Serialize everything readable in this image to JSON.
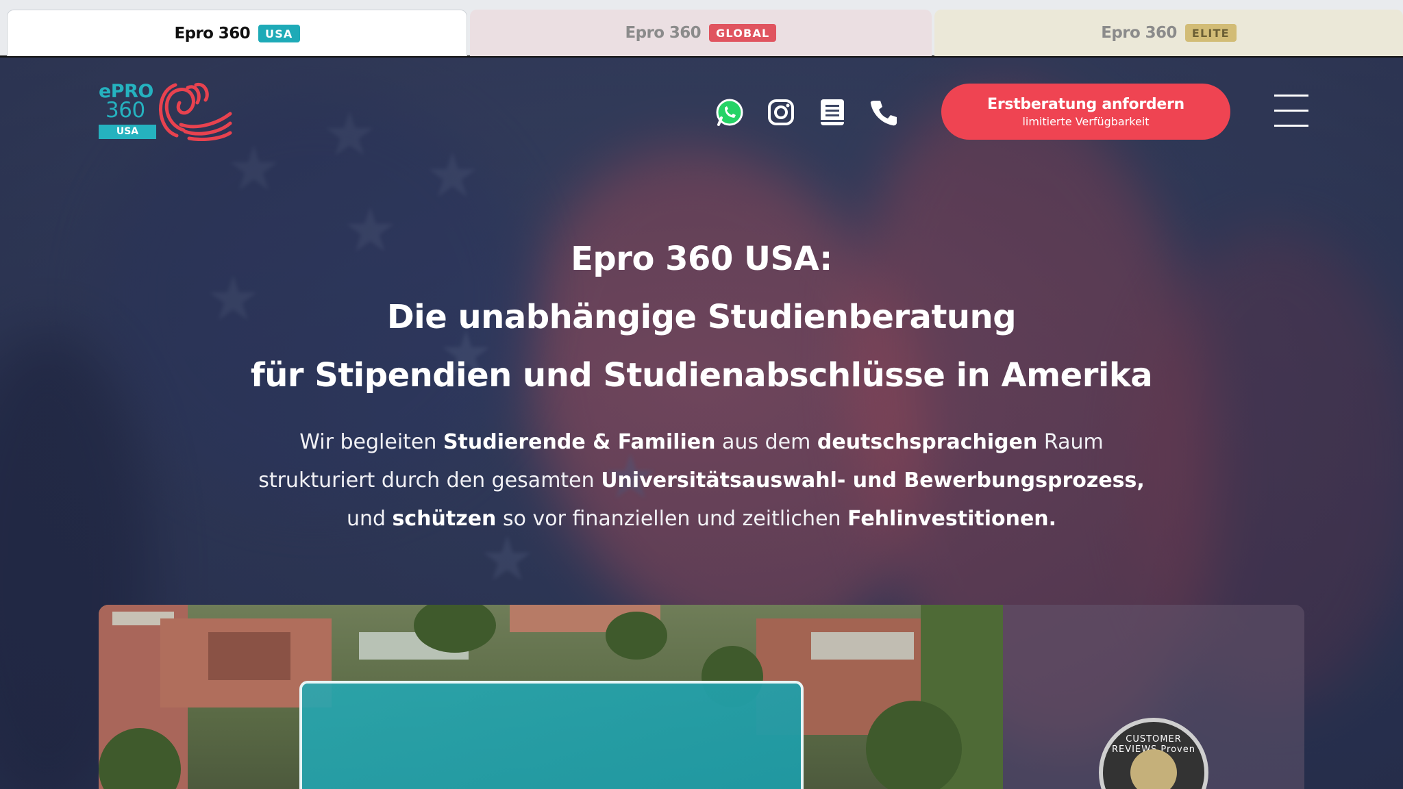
{
  "tabs": [
    {
      "name": "Epro 360",
      "badge": "USA"
    },
    {
      "name": "Epro 360",
      "badge": "GLOBAL"
    },
    {
      "name": "Epro 360",
      "badge": "ELITE"
    }
  ],
  "logo": {
    "line1": "ePRO",
    "line2": "360",
    "region": "USA"
  },
  "header": {
    "social_icons": [
      "whatsapp-icon",
      "instagram-icon",
      "book-icon",
      "phone-icon"
    ],
    "cta_label": "Erstberatung anfordern",
    "cta_sublabel": "limitierte Verfügbarkeit"
  },
  "hero": {
    "headline_lines": [
      "Epro 360 USA:",
      "Die unabhängige Studienberatung",
      "für Stipendien und Studienabschlüsse in Amerika"
    ],
    "lead": {
      "l1a": "Wir begleiten ",
      "l1b": "Studierende & Familien",
      "l1c": " aus dem ",
      "l1d": "deutschsprachigen",
      "l1e": " Raum",
      "l2a": "strukturiert durch den gesamten ",
      "l2b": "Universitätsauswahl- und Bewerbungsprozess,",
      "l3a": "und ",
      "l3b": "schützen",
      "l3c": " so vor finanziellen und zeitlichen ",
      "l3d": "Fehlinvestitionen."
    }
  },
  "badge_seal": {
    "text": "CUSTOMER REVIEWS Proven Expert"
  },
  "colors": {
    "accent": "#ef4452",
    "teal": "#25b2bf",
    "hero_bg": "#343e5e"
  }
}
